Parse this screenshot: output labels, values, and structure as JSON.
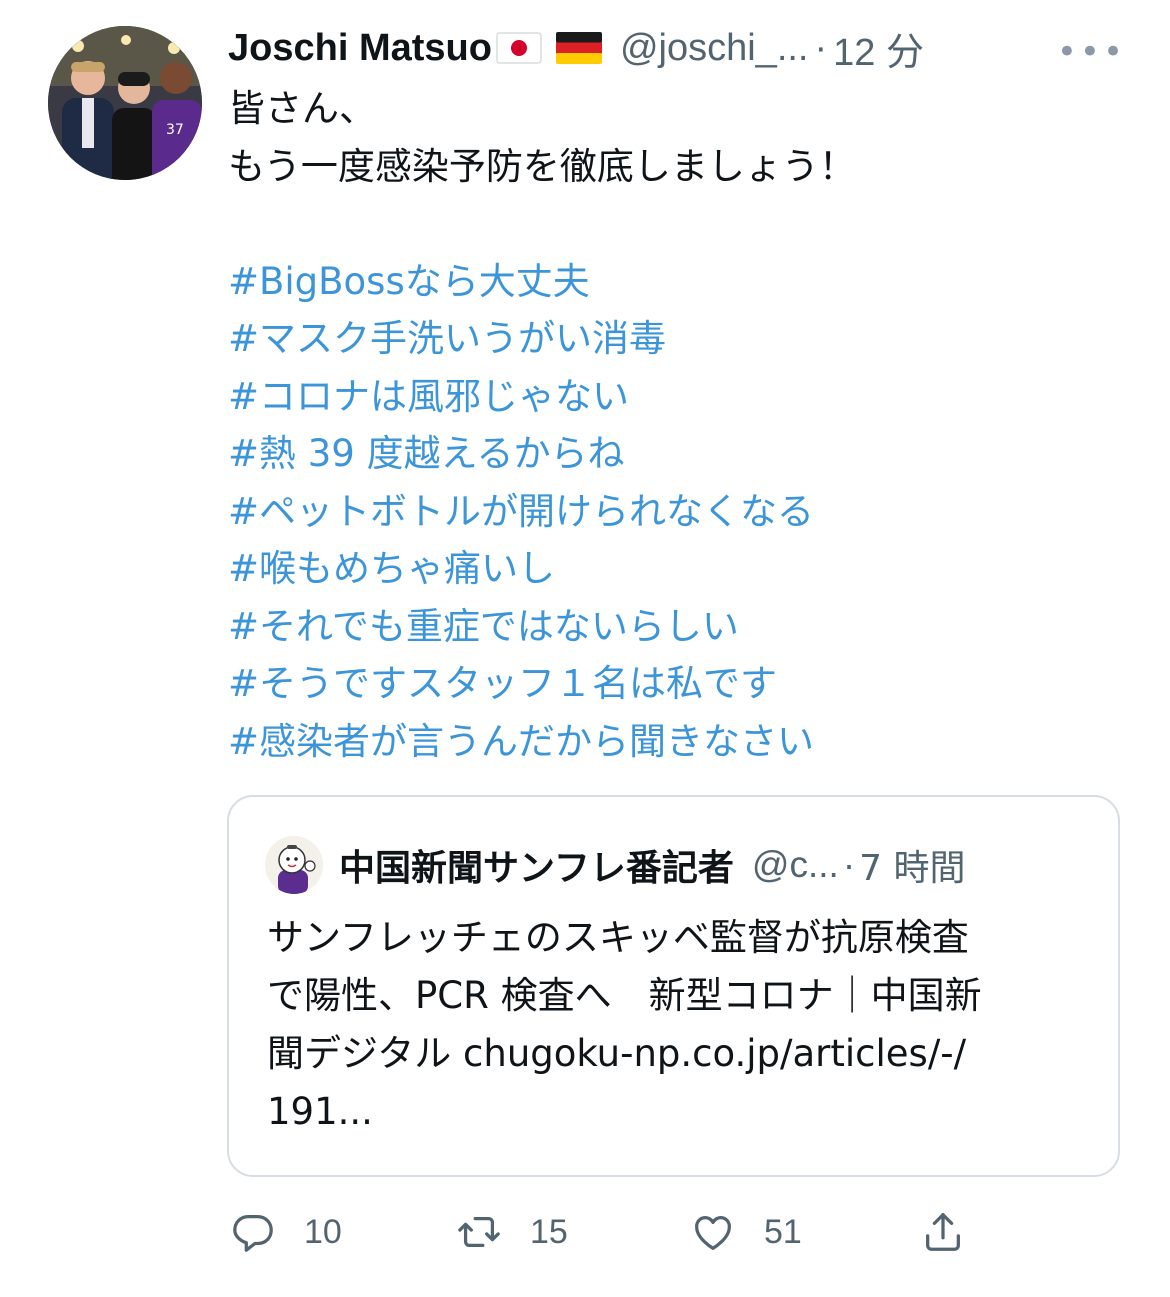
{
  "tweet": {
    "author_name": "Joschi Matsuo",
    "author_handle": "@joschi_...",
    "separator": "·",
    "time": "12 分",
    "more_label": "•••",
    "lines": [
      {
        "text": "皆さん、",
        "type": "plain"
      },
      {
        "text": "もう一度感染予防を徹底しましょう！",
        "type": "plain"
      },
      {
        "text": "",
        "type": "blank"
      },
      {
        "text": "#BigBossなら大丈夫",
        "type": "tag"
      },
      {
        "text": "#マスク手洗いうがい消毒",
        "type": "tag"
      },
      {
        "text": "#コロナは風邪じゃない",
        "type": "tag"
      },
      {
        "text": "#熱 39 度越えるからね",
        "type": "tag"
      },
      {
        "text": "#ペットボトルが開けられなくなる",
        "type": "tag"
      },
      {
        "text": "#喉もめちゃ痛いし",
        "type": "tag"
      },
      {
        "text": "#それでも重症ではないらしい",
        "type": "tag"
      },
      {
        "text": "#そうですスタッフ１名は私です",
        "type": "tag"
      },
      {
        "text": "#感染者が言うんだから聞きなさい",
        "type": "tag"
      }
    ]
  },
  "quoted": {
    "author_name": "中国新聞サンフレ番記者",
    "author_handle": "@c...",
    "separator": "·",
    "time": "7 時間",
    "lines": [
      "サンフレッチェのスキッベ監督が抗原検査",
      "で陽性、PCR 検査へ　新型コロナ｜中国新",
      "聞デジタル chugoku-np.co.jp/articles/-/",
      "191..."
    ]
  },
  "actions": {
    "reply_count": "10",
    "retweet_count": "15",
    "like_count": "51"
  },
  "colors": {
    "hashtag": "#3d95d9",
    "secondary": "#536471",
    "border": "#d7dde2"
  },
  "icons": {
    "reply": "reply-icon",
    "retweet": "retweet-icon",
    "like": "heart-icon",
    "share": "share-icon"
  }
}
